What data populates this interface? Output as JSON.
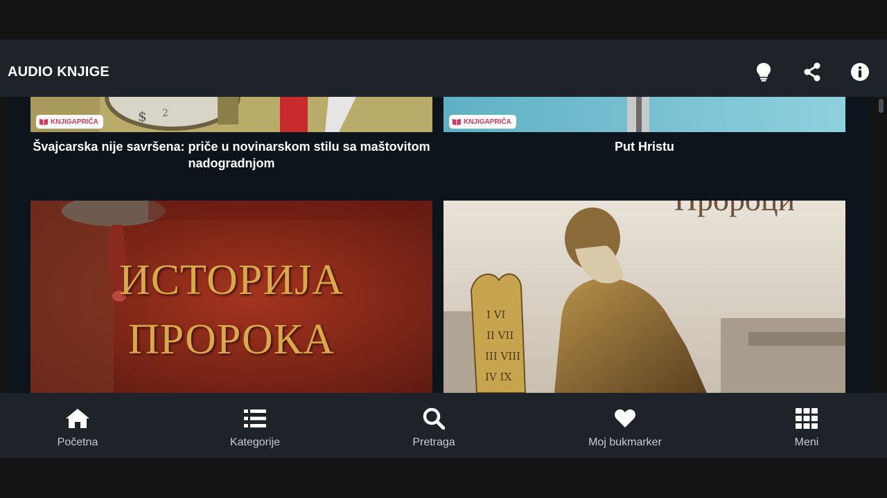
{
  "app": {
    "title": "AUDIO KNJIGE",
    "toolbar_icons": [
      "lightbulb-icon",
      "share-icon",
      "info-icon"
    ]
  },
  "books": [
    {
      "title": "Švajcarska nije savršena: priče u novinarskom stilu sa maštovitom nadogradnjom",
      "badge": "KNJIGAPRIČA"
    },
    {
      "title": "Put Hristu",
      "badge": "KNJIGAPRIČA"
    },
    {
      "cover_line1": "ИСТОРИЈА",
      "cover_line2": "ПРОРОКА"
    },
    {
      "cover_text": "Пророци"
    }
  ],
  "nav": [
    {
      "label": "Početna",
      "icon": "home-icon"
    },
    {
      "label": "Kategorije",
      "icon": "list-icon"
    },
    {
      "label": "Pretraga",
      "icon": "search-icon"
    },
    {
      "label": "Moj bukmarker",
      "icon": "heart-icon"
    },
    {
      "label": "Meni",
      "icon": "grid-icon"
    }
  ],
  "colors": {
    "bar_bg": "#1e2329",
    "content_bg": "#0e141b",
    "badge_red": "#d4385a"
  }
}
